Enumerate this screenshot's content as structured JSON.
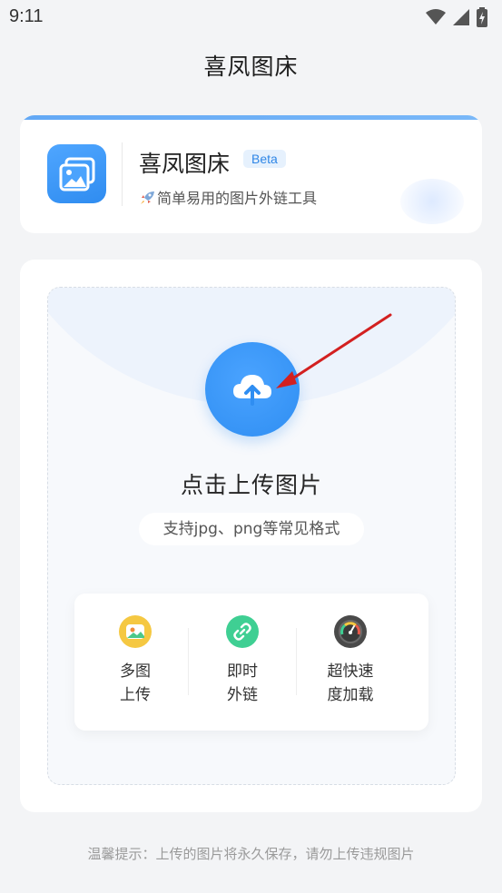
{
  "status_bar": {
    "time": "9:11"
  },
  "app_title": "喜凤图床",
  "header": {
    "name": "喜凤图床",
    "badge": "Beta",
    "tagline": "简单易用的图片外链工具"
  },
  "upload": {
    "title": "点击上传图片",
    "formats": "支持jpg、png等常见格式"
  },
  "features": [
    {
      "line1": "多图",
      "line2": "上传",
      "icon": "image-icon"
    },
    {
      "line1": "即时",
      "line2": "外链",
      "icon": "link-icon"
    },
    {
      "line1": "超快速",
      "line2": "度加载",
      "icon": "speedometer-icon"
    }
  ],
  "footer_note": "温馨提示：上传的图片将永久保存，请勿上传违规图片",
  "colors": {
    "accent": "#2f8ef2",
    "badge_bg": "#e6f1fd",
    "feature1": "#f5c842",
    "feature2": "#3fcf93",
    "feature3": "#4a4a4a",
    "arrow": "#d32020"
  }
}
